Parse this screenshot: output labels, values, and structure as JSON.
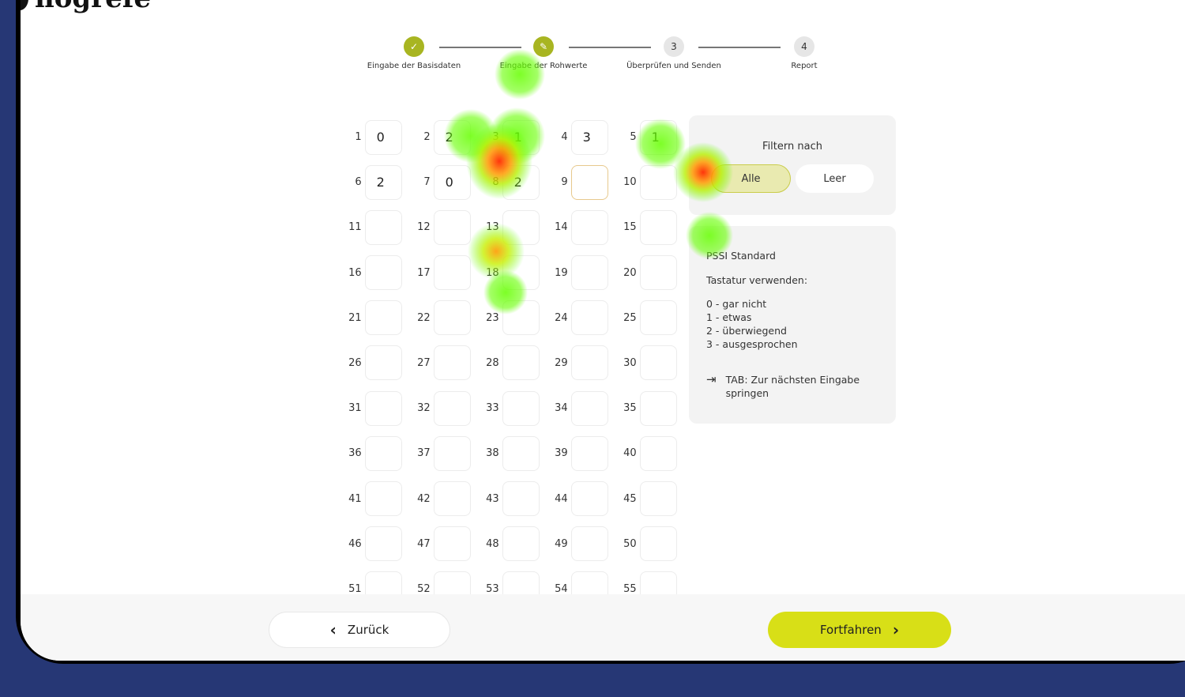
{
  "brand": {
    "name": "hogrefe"
  },
  "stepper": {
    "steps": [
      {
        "label": "Eingabe der Basisdaten",
        "state": "done",
        "marker": "✓"
      },
      {
        "label": "Eingabe der Rohwerte",
        "state": "current",
        "marker": "✎"
      },
      {
        "label": "Überprüfen und Senden",
        "state": "todo",
        "marker": "3"
      },
      {
        "label": "Report",
        "state": "todo",
        "marker": "4"
      }
    ]
  },
  "grid": {
    "items": [
      {
        "n": "1",
        "v": "0"
      },
      {
        "n": "2",
        "v": "2"
      },
      {
        "n": "3",
        "v": "1"
      },
      {
        "n": "4",
        "v": "3"
      },
      {
        "n": "5",
        "v": "1"
      },
      {
        "n": "6",
        "v": "2"
      },
      {
        "n": "7",
        "v": "0"
      },
      {
        "n": "8",
        "v": "2"
      },
      {
        "n": "9",
        "v": ""
      },
      {
        "n": "10",
        "v": ""
      },
      {
        "n": "11",
        "v": ""
      },
      {
        "n": "12",
        "v": ""
      },
      {
        "n": "13",
        "v": ""
      },
      {
        "n": "14",
        "v": ""
      },
      {
        "n": "15",
        "v": ""
      },
      {
        "n": "16",
        "v": ""
      },
      {
        "n": "17",
        "v": ""
      },
      {
        "n": "18",
        "v": ""
      },
      {
        "n": "19",
        "v": ""
      },
      {
        "n": "20",
        "v": ""
      },
      {
        "n": "21",
        "v": ""
      },
      {
        "n": "22",
        "v": ""
      },
      {
        "n": "23",
        "v": ""
      },
      {
        "n": "24",
        "v": ""
      },
      {
        "n": "25",
        "v": ""
      },
      {
        "n": "26",
        "v": ""
      },
      {
        "n": "27",
        "v": ""
      },
      {
        "n": "28",
        "v": ""
      },
      {
        "n": "29",
        "v": ""
      },
      {
        "n": "30",
        "v": ""
      },
      {
        "n": "31",
        "v": ""
      },
      {
        "n": "32",
        "v": ""
      },
      {
        "n": "33",
        "v": ""
      },
      {
        "n": "34",
        "v": ""
      },
      {
        "n": "35",
        "v": ""
      },
      {
        "n": "36",
        "v": ""
      },
      {
        "n": "37",
        "v": ""
      },
      {
        "n": "38",
        "v": ""
      },
      {
        "n": "39",
        "v": ""
      },
      {
        "n": "40",
        "v": ""
      },
      {
        "n": "41",
        "v": ""
      },
      {
        "n": "42",
        "v": ""
      },
      {
        "n": "43",
        "v": ""
      },
      {
        "n": "44",
        "v": ""
      },
      {
        "n": "45",
        "v": ""
      },
      {
        "n": "46",
        "v": ""
      },
      {
        "n": "47",
        "v": ""
      },
      {
        "n": "48",
        "v": ""
      },
      {
        "n": "49",
        "v": ""
      },
      {
        "n": "50",
        "v": ""
      },
      {
        "n": "51",
        "v": ""
      },
      {
        "n": "52",
        "v": ""
      },
      {
        "n": "53",
        "v": ""
      },
      {
        "n": "54",
        "v": ""
      },
      {
        "n": "55",
        "v": ""
      }
    ],
    "active_item": "9"
  },
  "filter": {
    "title": "Filtern nach",
    "options": [
      {
        "label": "Alle",
        "selected": true
      },
      {
        "label": "Leer",
        "selected": false
      }
    ]
  },
  "info": {
    "standard": "PSSI Standard",
    "keyboard": "Tastatur verwenden:",
    "legend": [
      "0 - gar nicht",
      "1 - etwas",
      "2 - überwiegend",
      "3 - ausgesprochen"
    ],
    "tab_icon": "tab-arrow-icon",
    "tab_text": "TAB: Zur nächsten Eingabe springen"
  },
  "footer": {
    "back_label": "Zurück",
    "next_label": "Fortfahren"
  },
  "colors": {
    "accent": "#d8df17",
    "step_done": "#a8b521",
    "frame": "#263775"
  }
}
